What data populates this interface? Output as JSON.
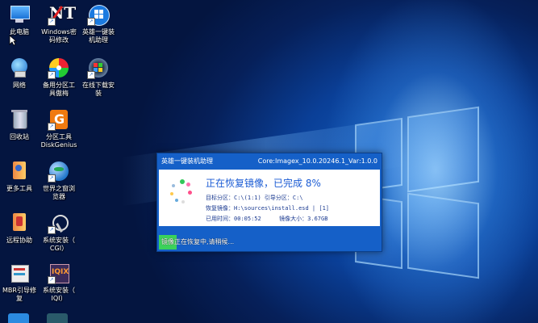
{
  "desktop": {
    "icons": [
      {
        "label": "此电脑",
        "icon": "computer-icon"
      },
      {
        "label": "Windows密\n码修改",
        "icon": "nt-password-icon"
      },
      {
        "label": "英雄一键装\n机助理",
        "icon": "windows-installer-icon"
      },
      {
        "label": "网络",
        "icon": "network-icon"
      },
      {
        "label": "备用分区工\n具傲梅",
        "icon": "partition-disc-icon"
      },
      {
        "label": "在线下载安\n装",
        "icon": "online-install-icon"
      },
      {
        "label": "回收站",
        "icon": "recycle-bin-icon"
      },
      {
        "label": "分区工具\nDiskGenius",
        "icon": "diskgenius-icon"
      },
      {
        "label": "更多工具",
        "icon": "more-tools-icon"
      },
      {
        "label": "世界之窗浏\n览器",
        "icon": "browser-globe-icon"
      },
      {
        "label": "远程协助",
        "icon": "remote-assist-icon"
      },
      {
        "label": "系统安装（\nCGI）",
        "icon": "cgi-install-icon"
      },
      {
        "label": "MBR引导修\n复",
        "icon": "mbr-repair-icon"
      },
      {
        "label": "系统安装（\nIQI）",
        "icon": "iqi-install-icon"
      }
    ]
  },
  "dialog": {
    "title": "英雄一键装机助理",
    "version": "Core:Imagex_10.0.20246.1_Var:1.0.0",
    "status": "正在恢复镜像，已完成 8%",
    "target_label": "目标分区：",
    "target_value": "C:\\(1:1) 引导分区：C:\\",
    "image_label": "恢复镜像：",
    "image_value": "H:\\sources\\install.esd | [1]",
    "elapsed_label": "已用时间：",
    "elapsed_value": "00:05:52",
    "size_label": "镜像大小：",
    "size_value": "3.67GB",
    "footer": "镜像正在恢复中,请稍候...",
    "progress_percent": 8
  },
  "colors": {
    "accent": "#1560c8",
    "progress": "#3bd25a",
    "status_text": "#1a5bd4"
  }
}
